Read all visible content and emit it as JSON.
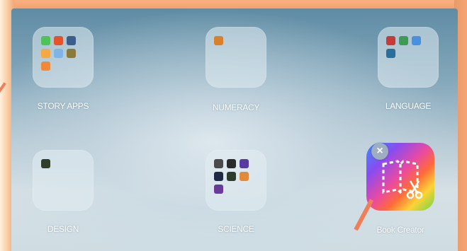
{
  "home_screen": {
    "folders": [
      {
        "label": "STORY APPS"
      },
      {
        "label": "NUMERACY"
      },
      {
        "label": "LANGUAGE"
      },
      {
        "label": "DESIGN"
      },
      {
        "label": "SCIENCE"
      }
    ],
    "app": {
      "label": "Book Creator"
    },
    "delete_badge": "×"
  },
  "colors": {
    "frame_orange": "#f6b98a",
    "annotation_arrow": "#ef7f5a",
    "folder_bg": "rgba(225,236,243,0.55)"
  }
}
